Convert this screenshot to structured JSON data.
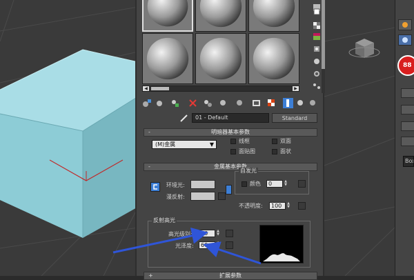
{
  "material_name": "01 - Default",
  "material_type_button": "Standard",
  "shader_rollout": {
    "title": "明暗器基本参数",
    "shader_type": "(M)金属",
    "wire_label": "线框",
    "two_sided_label": "双面",
    "face_map_label": "面贴图",
    "faceted_label": "面状"
  },
  "metal_rollout": {
    "title": "金属基本参数",
    "ambient_label": "环境光:",
    "diffuse_label": "漫反射:",
    "self_illum_group": "自发光",
    "color_label": "颜色",
    "self_illum_value": "0",
    "opacity_label": "不透明度:",
    "opacity_value": "100",
    "specular_group": "反射高光",
    "spec_level_label": "高光级别:",
    "spec_level_value": "50",
    "glossiness_label": "光泽度:",
    "glossiness_value": "60"
  },
  "next_rollout_title": "扩展参数",
  "command_panel": {
    "red_badge": "88",
    "object_name": "Box"
  },
  "colors": {
    "cube_top": "#a9dde6",
    "cube_front": "#8dccd6",
    "cube_side": "#78b7c1",
    "arrow": "#2f55d8",
    "red_badge": "#d81e1e"
  },
  "icons": {
    "pick_material": "eyedropper-icon",
    "delete": "x-icon",
    "show_in_viewport": "checker-icon"
  }
}
